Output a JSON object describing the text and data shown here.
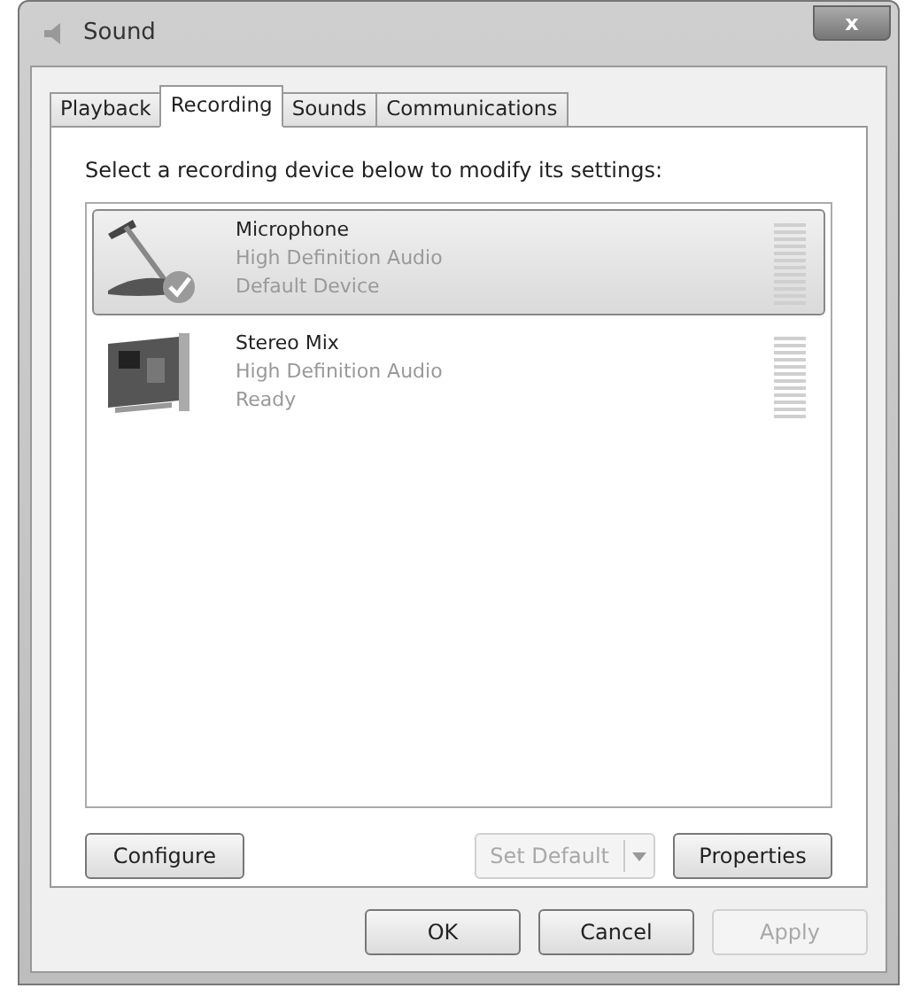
{
  "window": {
    "title": "Sound",
    "close": "x"
  },
  "tabs": [
    {
      "label": "Playback",
      "selected": false
    },
    {
      "label": "Recording",
      "selected": true
    },
    {
      "label": "Sounds",
      "selected": false
    },
    {
      "label": "Communications",
      "selected": false
    }
  ],
  "instruction": "Select a recording device below to modify its settings:",
  "devices": [
    {
      "kind": "microphone",
      "name": "Microphone",
      "driver": "High Definition Audio",
      "status": "Default Device",
      "selected": true,
      "is_default": true
    },
    {
      "kind": "sound-card",
      "name": "Stereo Mix",
      "driver": "High Definition Audio",
      "status": "Ready",
      "selected": false,
      "is_default": false
    }
  ],
  "panel_buttons": {
    "configure": {
      "label": "Configure",
      "disabled": false
    },
    "set_default": {
      "label": "Set Default",
      "disabled": true
    },
    "properties": {
      "label": "Properties",
      "disabled": false
    }
  },
  "dialog_buttons": [
    {
      "label": "OK",
      "disabled": false
    },
    {
      "label": "Cancel",
      "disabled": false
    },
    {
      "label": "Apply",
      "disabled": true
    }
  ]
}
